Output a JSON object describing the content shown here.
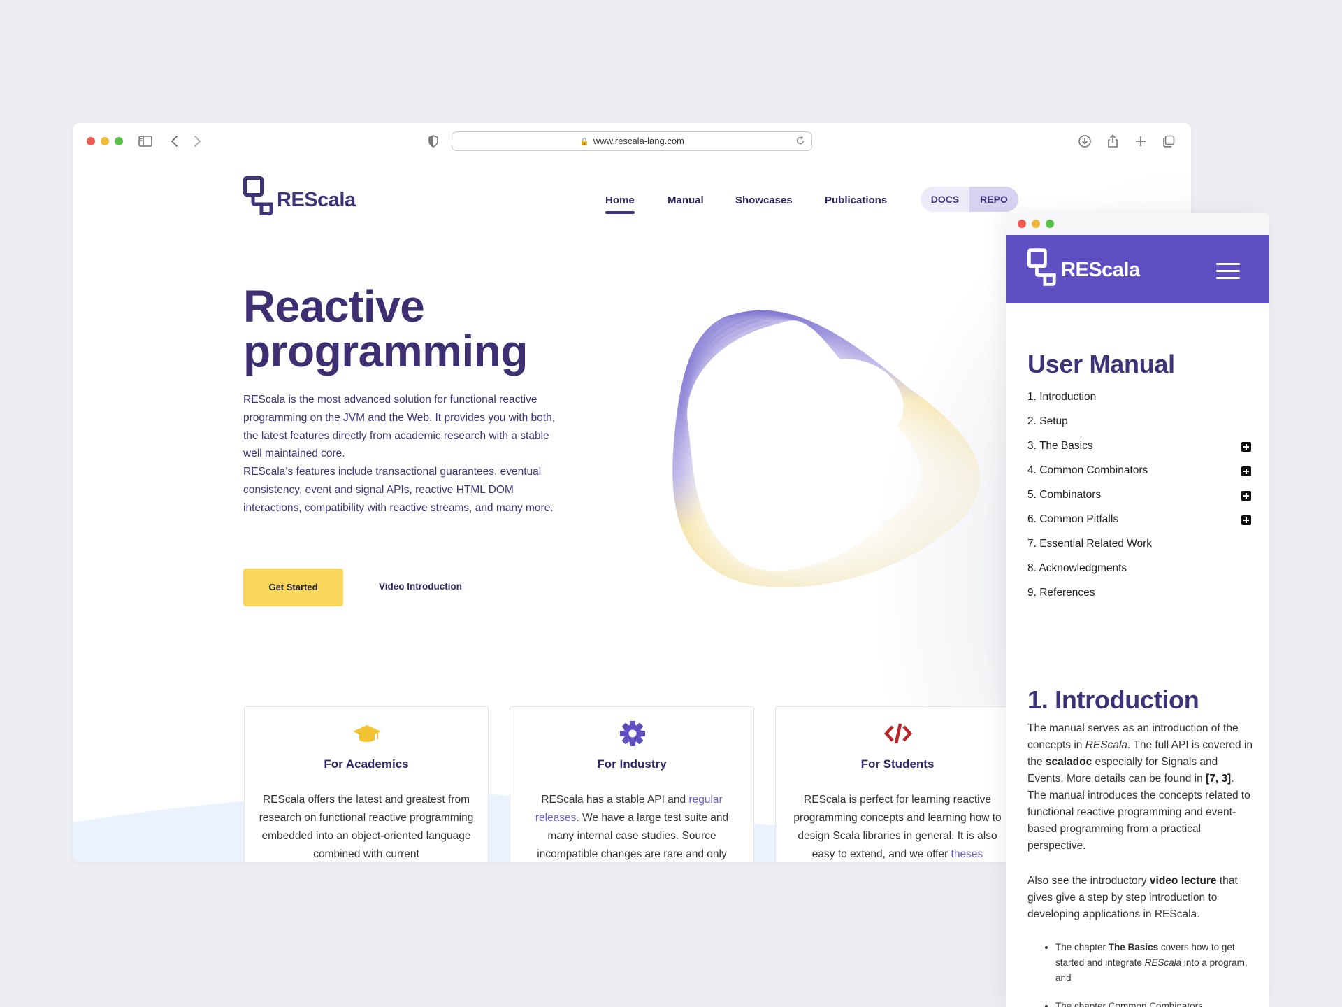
{
  "browser": {
    "url": "www.rescala-lang.com"
  },
  "site": {
    "brand": "REScala",
    "nav": [
      "Home",
      "Manual",
      "Showcases",
      "Publications"
    ],
    "docs_label": "DOCS",
    "repo_label": "REPO"
  },
  "hero": {
    "title_line1": "Reactive",
    "title_line2": "programming",
    "para1": "REScala is the most advanced solution for functional reactive programming on the JVM and the Web. It provides you with both, the latest features directly from academic research with a stable well maintained core.",
    "para2": "REScala’s features include transactional guarantees, eventual consistency, event and signal APIs, reactive HTML DOM interactions, compatibility with reactive streams, and many more.",
    "cta_primary": "Get Started",
    "cta_secondary": "Video Introduction"
  },
  "cards": [
    {
      "title": "For Academics",
      "icon": "graduation-cap-icon",
      "text": "REScala offers the latest and greatest from research on functional reactive programming embedded into an object-oriented language combined with current"
    },
    {
      "title": "For Industry",
      "icon": "gear-icon",
      "text_before": "REScala has a stable API and ",
      "link": "regular releases",
      "text_after": ". We have a large test suite and many internal case studies. Source incompatible changes are rare and only"
    },
    {
      "title": "For Students",
      "icon": "code-icon",
      "text_before": "REScala is perfect for learning reactive programming concepts and learning how to design Scala libraries in general. It is also easy to extend, and we offer ",
      "link": "theses"
    }
  ],
  "mobile": {
    "brand": "REScala",
    "manual_title": "User Manual",
    "toc": [
      {
        "label": "1. Introduction",
        "expandable": false
      },
      {
        "label": "2. Setup",
        "expandable": false
      },
      {
        "label": "3. The Basics",
        "expandable": true
      },
      {
        "label": "4. Common Combinators",
        "expandable": true
      },
      {
        "label": "5. Combinators",
        "expandable": true
      },
      {
        "label": "6. Common Pitfalls",
        "expandable": true
      },
      {
        "label": "7. Essential Related Work",
        "expandable": false
      },
      {
        "label": "8. Acknowledgments",
        "expandable": false
      },
      {
        "label": "9. References",
        "expandable": false
      }
    ],
    "intro_title": "1. Introduction",
    "intro": {
      "t1": "The manual serves as an introduction of the concepts in ",
      "em1": "REScala",
      "t2": ". The full API is covered in the ",
      "link1": "scaladoc",
      "t3": " especially for Signals and Events. More details can be found in ",
      "link2": "[7, 3]",
      "t4": ". The manual introduces the concepts related to functional reactive programming and event-based programming from a practical perspective."
    },
    "also": {
      "t1": "Also see the introductory ",
      "link": "video lecture",
      "t2": " that gives give a step by step introduction to developing applications in REScala."
    },
    "bullet1": {
      "t1": "The chapter ",
      "link": "The Basics",
      "t2": " covers how to get started and integrate ",
      "em": "REScala",
      "t3": " into a program, and"
    },
    "bullet2_partial": "The chapter Common Combinators"
  },
  "colors": {
    "brand_purple": "#5e4fc2",
    "heading": "#3d2f72",
    "cta_yellow": "#f8d75a",
    "academics_icon": "#f2c230",
    "industry_icon": "#5e4fc2",
    "students_icon": "#b8262a"
  }
}
